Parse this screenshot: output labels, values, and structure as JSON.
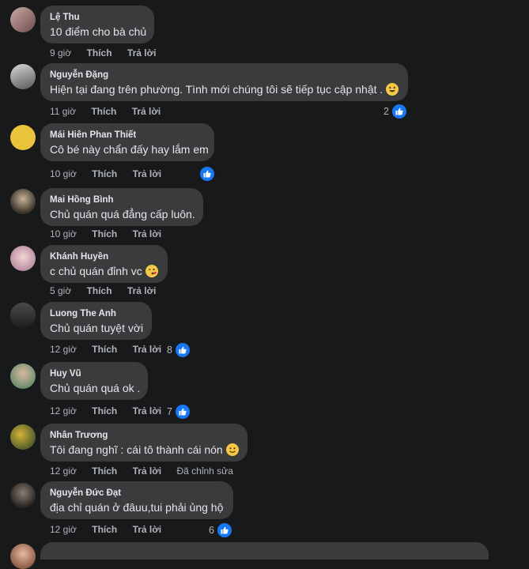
{
  "actions": {
    "like": "Thích",
    "reply": "Trả lời",
    "edited": "Đã chỉnh sửa"
  },
  "colors": {
    "bubble": "#3a3b3c",
    "background": "#18191a",
    "like_badge": "#1877f2",
    "meta_text": "#b0b3b8"
  },
  "comments": [
    {
      "author": "Lệ Thu",
      "text": "10 điểm cho bà chủ",
      "time": "9 giờ",
      "reactions": "",
      "emoji": ""
    },
    {
      "author": "Nguyễn Đặng",
      "text": "Hiện tại đang trên phường. Tình mới chúng tôi sẽ tiếp tục cập nhật .",
      "time": "11 giờ",
      "reactions": "2",
      "emoji": "grinning-emoji"
    },
    {
      "author": "Mái Hiên Phan Thiết",
      "text": "Cô bé này chẩn đấy hay lắm em",
      "time": "10 giờ",
      "reactions": "",
      "emoji": ""
    },
    {
      "author": "Mai Hồng Bình",
      "text": "Chủ quán quá đẳng cấp luôn.",
      "time": "10 giờ",
      "reactions": "",
      "emoji": ""
    },
    {
      "author": "Khánh Huyền",
      "text": "c chủ quán đỉnh vc",
      "time": "5 giờ",
      "reactions": "",
      "emoji": "kiss-emoji"
    },
    {
      "author": "Luong The Anh",
      "text": "Chủ quán tuyệt vời",
      "time": "12 giờ",
      "reactions": "8",
      "emoji": ""
    },
    {
      "author": "Huy Vũ",
      "text": "Chủ quán quá ok .",
      "time": "12 giờ",
      "reactions": "7",
      "emoji": ""
    },
    {
      "author": "Nhân Trương",
      "text": "Tôi đang nghĩ : cái tô thành cái nón",
      "time": "12 giờ",
      "reactions": "",
      "emoji": "smile-emoji"
    },
    {
      "author": "Nguyễn Đức Đạt",
      "text": "địa chỉ quán ở đâuu,tui phải ủng hộ",
      "time": "12 giờ",
      "reactions": "6",
      "emoji": ""
    }
  ]
}
